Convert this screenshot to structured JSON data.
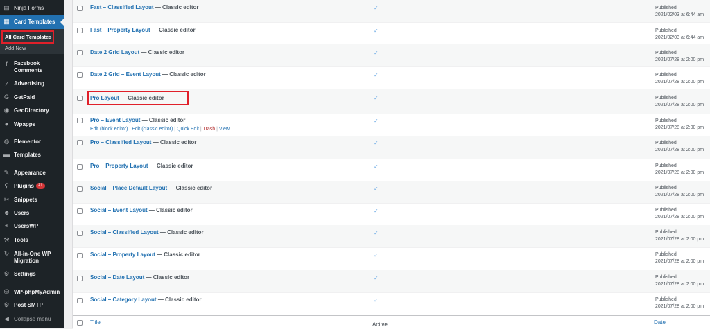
{
  "sidebar": {
    "top_item": {
      "label": "Ninja Forms",
      "icon": "form-icon"
    },
    "current_item": {
      "label": "Card Templates",
      "icon": "card-icon"
    },
    "submenu": [
      {
        "label": "All Card Templates",
        "current": true
      },
      {
        "label": "Add New",
        "current": false
      }
    ],
    "items": [
      {
        "label": "Facebook Comments",
        "label_line2": "",
        "icon": "facebook-icon"
      },
      {
        "label": "Advertising",
        "icon": "chart-icon"
      },
      {
        "label": "GetPaid",
        "icon": "getpaid-icon"
      },
      {
        "label": "GeoDirectory",
        "icon": "globe-icon"
      },
      {
        "label": "Wpapps",
        "icon": "wpapps-icon"
      },
      {
        "label": "Elementor",
        "icon": "elementor-icon"
      },
      {
        "label": "Templates",
        "icon": "folder-icon"
      },
      {
        "label": "Appearance",
        "icon": "brush-icon"
      },
      {
        "label": "Plugins",
        "icon": "plugin-icon",
        "badge": "21"
      },
      {
        "label": "Snippets",
        "icon": "snippets-icon"
      },
      {
        "label": "Users",
        "icon": "users-icon"
      },
      {
        "label": "UsersWP",
        "icon": "userswp-icon"
      },
      {
        "label": "Tools",
        "icon": "wrench-icon"
      },
      {
        "label": "All-in-One WP Migration",
        "icon": "migration-icon"
      },
      {
        "label": "Settings",
        "icon": "settings-icon"
      },
      {
        "label": "WP-phpMyAdmin",
        "icon": "database-icon"
      },
      {
        "label": "Post SMTP",
        "icon": "gear-icon"
      },
      {
        "label": "Collapse menu",
        "icon": "collapse-icon"
      }
    ]
  },
  "table": {
    "rows": [
      {
        "title": "Fast – Classified Layout",
        "state": " — Classic editor",
        "status": "Published",
        "date": "2021/02/03 at 6:44 am"
      },
      {
        "title": "Fast – Property Layout",
        "state": " — Classic editor",
        "status": "Published",
        "date": "2021/02/03 at 6:44 am"
      },
      {
        "title": "Date 2 Grid Layout",
        "state": " — Classic editor",
        "status": "Published",
        "date": "2021/07/28 at 2:00 pm"
      },
      {
        "title": "Date 2 Grid – Event Layout",
        "state": " — Classic editor",
        "status": "Published",
        "date": "2021/07/28 at 2:00 pm"
      },
      {
        "title": "Pro Layout",
        "state": " — Classic editor",
        "status": "Published",
        "date": "2021/07/28 at 2:00 pm"
      },
      {
        "title": "Pro – Event Layout",
        "state": " — Classic editor",
        "status": "Published",
        "date": "2021/07/28 at 2:00 pm"
      },
      {
        "title": "Pro – Classified Layout",
        "state": " — Classic editor",
        "status": "Published",
        "date": "2021/07/28 at 2:00 pm"
      },
      {
        "title": "Pro – Property Layout",
        "state": " — Classic editor",
        "status": "Published",
        "date": "2021/07/28 at 2:00 pm"
      },
      {
        "title": "Social – Place Default Layout",
        "state": " — Classic editor",
        "status": "Published",
        "date": "2021/07/28 at 2:00 pm"
      },
      {
        "title": "Social – Event Layout",
        "state": " — Classic editor",
        "status": "Published",
        "date": "2021/07/28 at 2:00 pm"
      },
      {
        "title": "Social – Classified Layout",
        "state": " — Classic editor",
        "status": "Published",
        "date": "2021/07/28 at 2:00 pm"
      },
      {
        "title": "Social – Property Layout",
        "state": " — Classic editor",
        "status": "Published",
        "date": "2021/07/28 at 2:00 pm"
      },
      {
        "title": "Social – Date Layout",
        "state": " — Classic editor",
        "status": "Published",
        "date": "2021/07/28 at 2:00 pm"
      },
      {
        "title": "Social – Category Layout",
        "state": " — Classic editor",
        "status": "Published",
        "date": "2021/07/28 at 2:00 pm"
      }
    ],
    "row_actions": {
      "edit_block": "Edit (block editor)",
      "edit_classic": "Edit (classic editor)",
      "quick_edit": "Quick Edit",
      "trash": "Trash",
      "view": "View",
      "separator": " | "
    },
    "check_glyph": "✓",
    "footer": {
      "title": "Title",
      "active": "Active",
      "date": "Date"
    }
  }
}
